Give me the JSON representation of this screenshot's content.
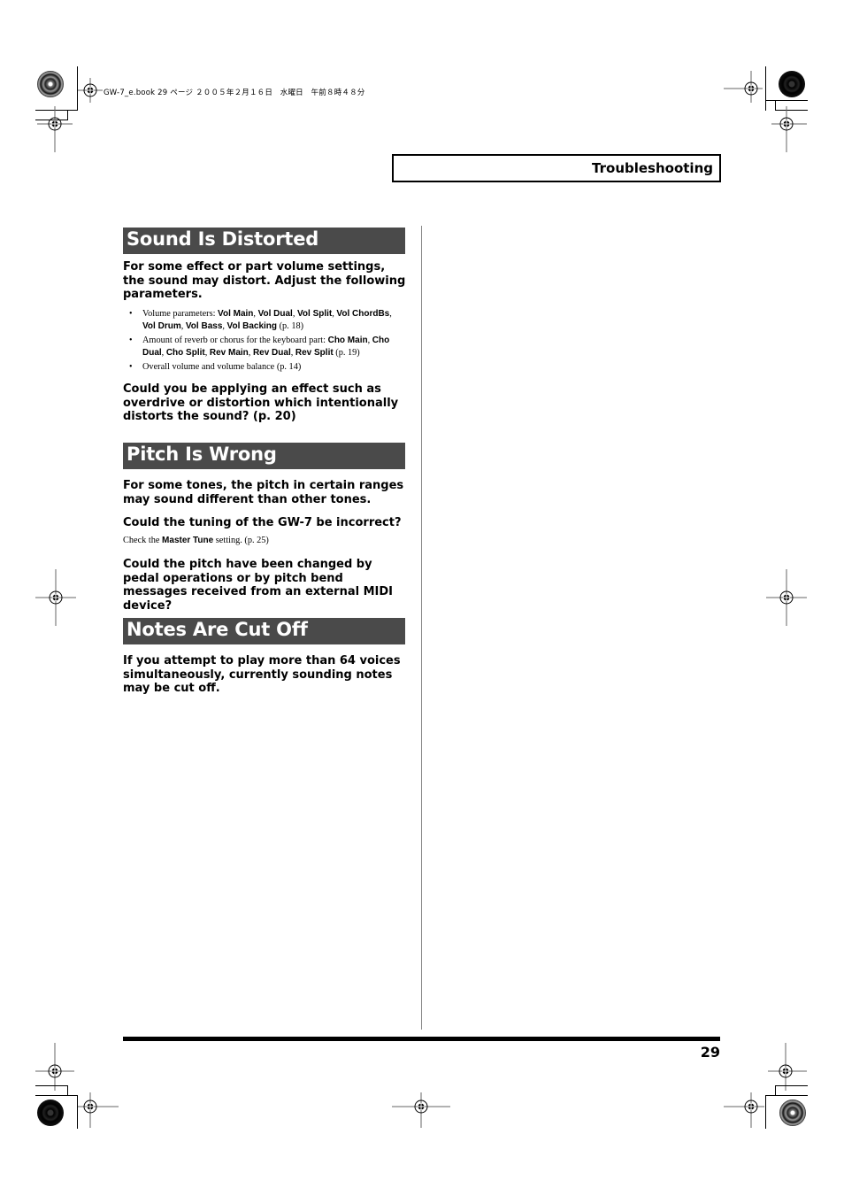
{
  "print_header": {
    "file_info": "GW-7_e.book  29 ページ  ２００５年２月１６日　水曜日　午前８時４８分"
  },
  "running_header": {
    "title": "Troubleshooting"
  },
  "sections": [
    {
      "title": "Sound Is Distorted",
      "lead": "For some effect or part volume settings, the sound may distort. Adjust the following parameters.",
      "bullets": [
        {
          "prefix": "Volume parameters: ",
          "keywords": [
            "Vol Main",
            "Vol Dual",
            "Vol Split",
            "Vol ChordBs",
            "Vol Drum",
            "Vol Bass",
            "Vol Backing"
          ],
          "suffix": " (p. 18)"
        },
        {
          "prefix": "Amount of reverb or chorus for the keyboard part: ",
          "keywords": [
            "Cho Main",
            "Cho Dual",
            "Cho Split",
            "Rev Main",
            "Rev Dual",
            "Rev Split"
          ],
          "suffix": " (p. 19)"
        },
        {
          "prefix": "Overall volume and volume balance (p. 14)",
          "keywords": [],
          "suffix": ""
        }
      ],
      "question": "Could you be applying an effect such as overdrive or distortion which intentionally distorts the sound? (p. 20)"
    },
    {
      "title": "Pitch Is Wrong",
      "lead": "For some tones, the pitch in certain ranges may sound different than other tones.",
      "question1": "Could the tuning of the GW-7 be incorrect?",
      "note": {
        "prefix": "Check the ",
        "keyword": "Master Tune",
        "suffix": " setting. (p. 25)"
      },
      "question2": "Could the pitch have been changed by pedal operations or by pitch bend messages received from an external MIDI device?"
    },
    {
      "title": "Notes Are Cut Off",
      "lead": "If you attempt to play more than 64 voices simultaneously, currently sounding notes may be cut off."
    }
  ],
  "footer": {
    "page_number": "29"
  }
}
